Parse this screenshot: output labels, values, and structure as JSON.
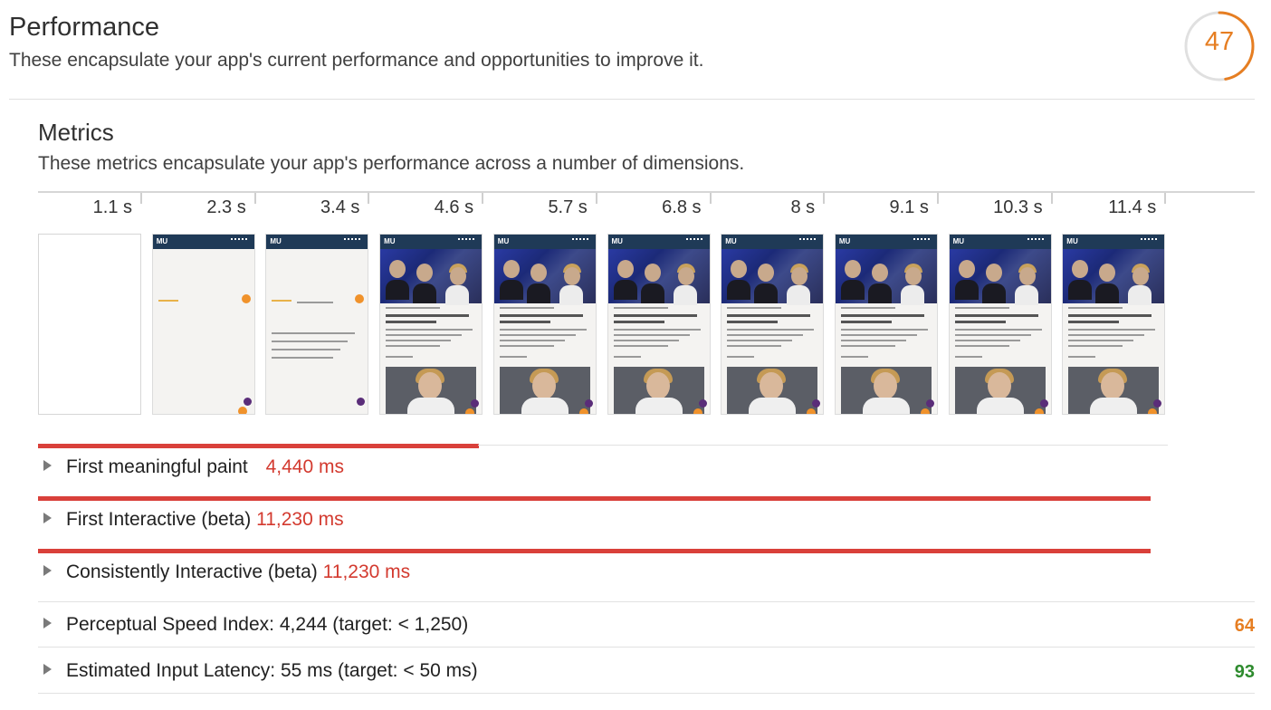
{
  "category": {
    "title": "Performance",
    "description": "These encapsulate your app's current performance and opportunities to improve it.",
    "score": "47",
    "score_fraction": 0.47,
    "score_color": "#e67e22"
  },
  "metrics_section": {
    "title": "Metrics",
    "description": "These metrics encapsulate your app's performance across a number of dimensions."
  },
  "filmstrip": {
    "timestamps": [
      "1.1 s",
      "2.3 s",
      "3.4 s",
      "4.6 s",
      "5.7 s",
      "6.8 s",
      "8 s",
      "9.1 s",
      "10.3 s",
      "11.4 s"
    ],
    "frame_logo": "MU"
  },
  "metrics": [
    {
      "label": "First meaningful paint",
      "value": "4,440 ms",
      "bar_fraction": 0.39
    },
    {
      "label": "First Interactive (beta)",
      "value": "11,230 ms",
      "bar_fraction": 0.985
    },
    {
      "label": "Consistently Interactive (beta)",
      "value": "11,230 ms",
      "bar_fraction": 0.985
    }
  ],
  "audits": [
    {
      "label": "Perceptual Speed Index: 4,244 (target: < 1,250)",
      "score": "64",
      "score_color": "#e67e22"
    },
    {
      "label": "Estimated Input Latency: 55 ms (target: < 50 ms)",
      "score": "93",
      "score_color": "#2e8b2e"
    }
  ],
  "colors": {
    "fail_red": "#d33a2f",
    "bar_red": "#d9403a",
    "average_orange": "#e67e22",
    "pass_green": "#2e8b2e"
  },
  "icons": {
    "expand": "triangle-right-icon"
  }
}
